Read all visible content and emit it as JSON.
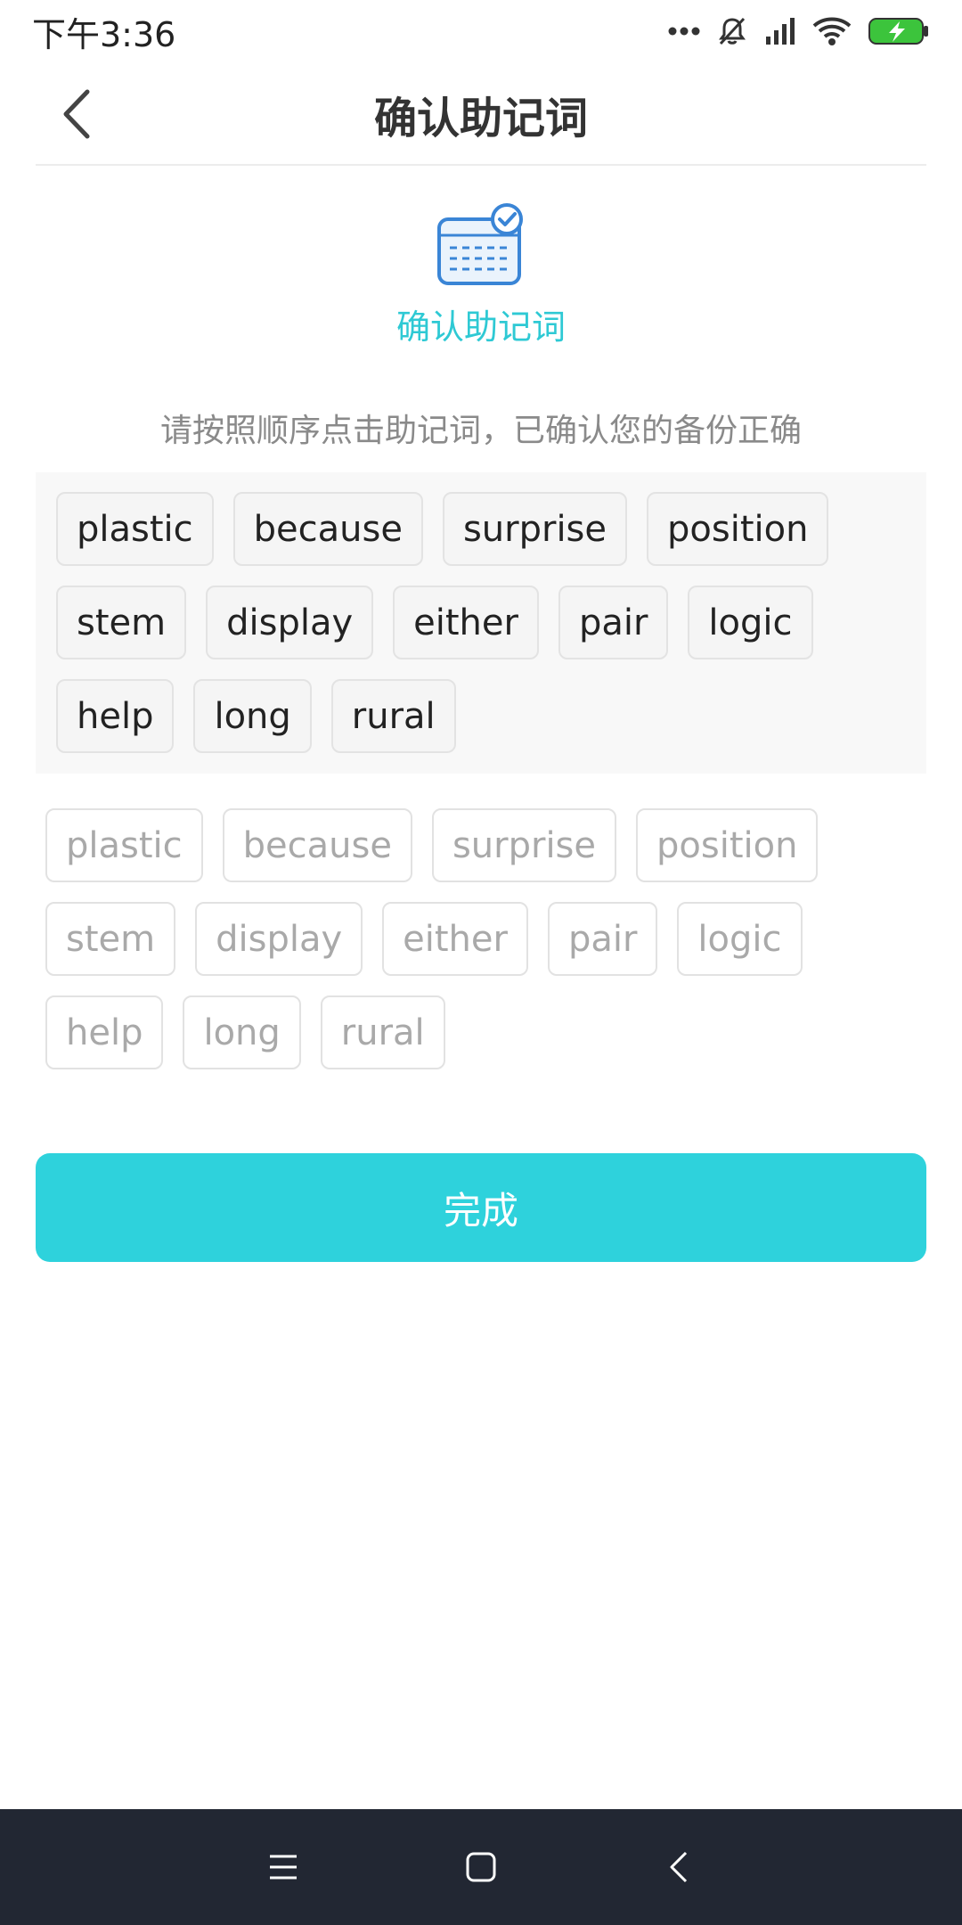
{
  "status_bar": {
    "time": "下午3:36",
    "icons": [
      "more-dots-icon",
      "mute-icon",
      "signal-icon",
      "wifi-icon",
      "battery-charging-icon"
    ],
    "battery_color": "#3cc43c"
  },
  "nav": {
    "title": "确认助记词",
    "back_icon": "chevron-left-icon"
  },
  "hero": {
    "icon": "mnemonic-card-check-icon",
    "label": "确认助记词"
  },
  "instruction": "请按照顺序点击助记词，已确认您的备份正确",
  "selected_words": [
    "plastic",
    "because",
    "surprise",
    "position",
    "stem",
    "display",
    "either",
    "pair",
    "logic",
    "help",
    "long",
    "rural"
  ],
  "word_pool": [
    "plastic",
    "because",
    "surprise",
    "position",
    "stem",
    "display",
    "either",
    "pair",
    "logic",
    "help",
    "long",
    "rural"
  ],
  "done_button": {
    "label": "完成"
  },
  "system_nav": {
    "icons": [
      "menu-icon",
      "home-icon",
      "back-icon"
    ]
  },
  "colors": {
    "accent": "#2ed2dc",
    "accent_text": "#2ec9d4",
    "system_nav_bg": "#222733"
  }
}
